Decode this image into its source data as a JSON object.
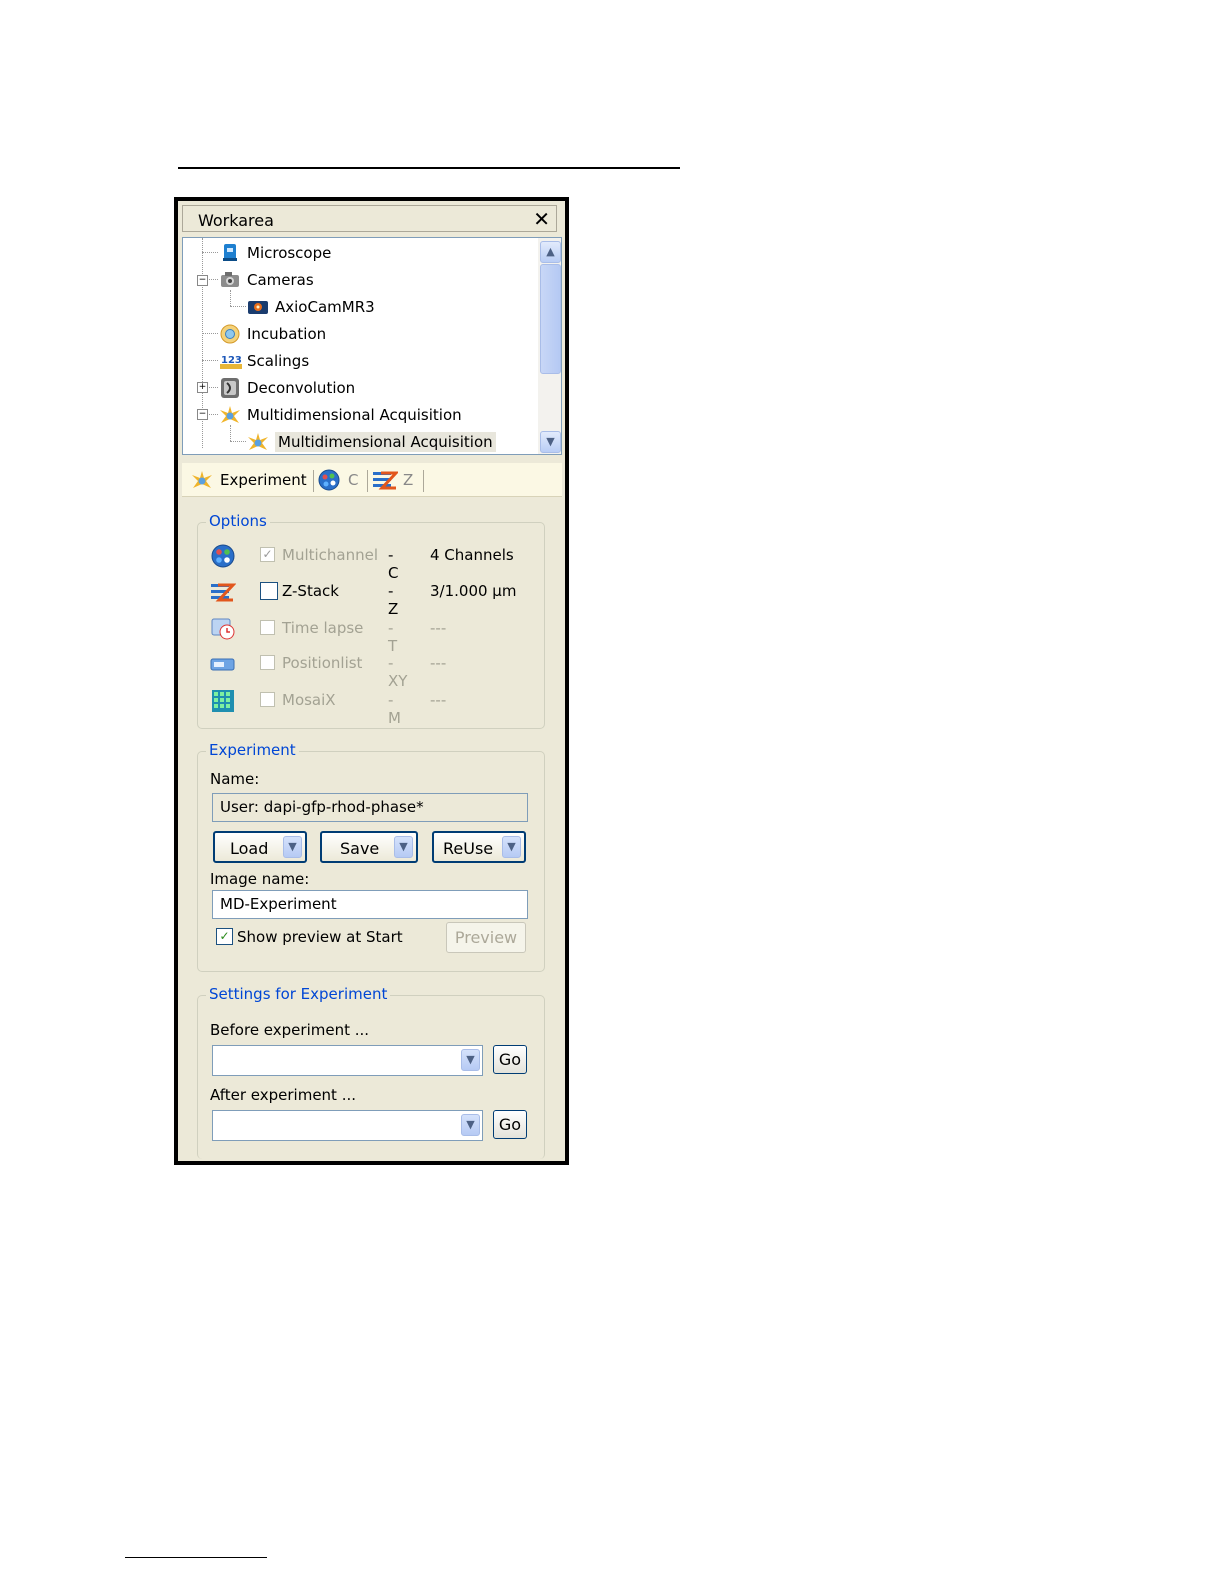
{
  "workarea": {
    "title": "Workarea",
    "close_label": "✕"
  },
  "tree": {
    "items": [
      {
        "label": "Microscope"
      },
      {
        "label": "Cameras"
      },
      {
        "label": "AxioCamMR3"
      },
      {
        "label": "Incubation"
      },
      {
        "label": "Scalings"
      },
      {
        "label": "Deconvolution"
      },
      {
        "label": "Multidimensional Acquisition"
      },
      {
        "label": "Multidimensional Acquisition"
      }
    ]
  },
  "tabs": [
    {
      "label": "Experiment"
    },
    {
      "label": "C"
    },
    {
      "label": "Z"
    }
  ],
  "options": {
    "title": "Options",
    "rows": [
      {
        "label": "Multichannel",
        "flag": "-C",
        "value": "4 Channels",
        "checked": true,
        "enabled": false
      },
      {
        "label": "Z-Stack",
        "flag": "-Z",
        "value": "3/1.000 µm",
        "checked": false,
        "enabled": true
      },
      {
        "label": "Time lapse",
        "flag": "-T",
        "value": "---",
        "checked": false,
        "enabled": false
      },
      {
        "label": "Positionlist",
        "flag": "-XY",
        "value": "---",
        "checked": false,
        "enabled": false
      },
      {
        "label": "MosaiX",
        "flag": "-M",
        "value": "---",
        "checked": false,
        "enabled": false
      }
    ]
  },
  "experiment": {
    "title": "Experiment",
    "name_label": "Name:",
    "name_value": "User: dapi-gfp-rhod-phase*",
    "load_label": "Load",
    "save_label": "Save",
    "reuse_label": "ReUse",
    "image_name_label": "Image name:",
    "image_name_value": "MD-Experiment",
    "show_preview_label": "Show preview at Start",
    "show_preview_checked": true,
    "preview_label": "Preview"
  },
  "settings": {
    "title": "Settings for Experiment",
    "before_label": "Before experiment ...",
    "before_value": "",
    "after_label": "After experiment ...",
    "after_value": "",
    "go_label": "Go"
  },
  "colors": {
    "panel_bg": "#ece9d8",
    "group_title": "#0046d5",
    "button_border": "#003c74",
    "disabled_text": "#a3a293"
  }
}
